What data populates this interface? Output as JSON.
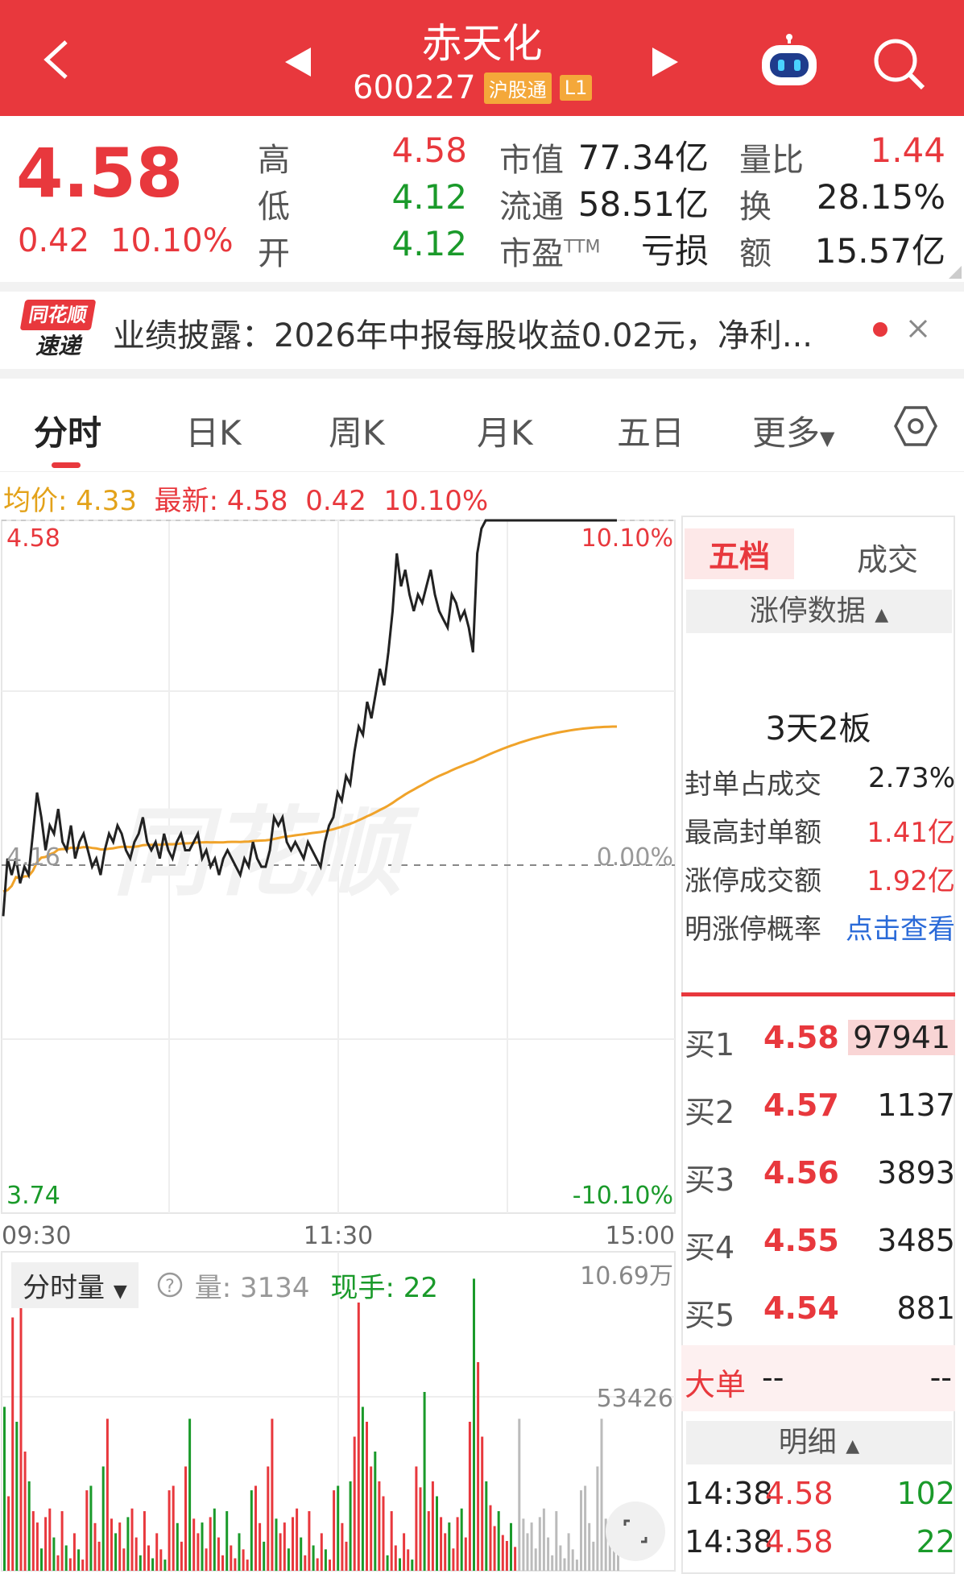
{
  "header": {
    "title": "赤天化",
    "code": "600227",
    "tags": [
      "沪股通",
      "L1"
    ]
  },
  "quote": {
    "price": "4.58",
    "change": "0.42",
    "change_pct": "10.10%",
    "high_label": "高",
    "high": "4.58",
    "low_label": "低",
    "low": "4.12",
    "open_label": "开",
    "open": "4.12",
    "mcap_label": "市值",
    "mcap": "77.34亿",
    "float_label": "流通",
    "float": "58.51亿",
    "pe_label": "市盈",
    "pe_sup": "TTM",
    "pe": "亏损",
    "vr_label": "量比",
    "vr": "1.44",
    "turn_label": "换",
    "turn": "28.15%",
    "amt_label": "额",
    "amt": "15.57亿"
  },
  "news": {
    "logo_top": "同花顺",
    "logo_bottom": "速递",
    "text": "业绩披露：2026年中报每股收益0.02元，净利..."
  },
  "tabs": [
    "分时",
    "日K",
    "周K",
    "月K",
    "五日",
    "更多"
  ],
  "summary": {
    "avg": "均价: 4.33",
    "latest": "最新: 4.58",
    "chg": "0.42",
    "pct": "10.10%"
  },
  "chart": {
    "y_top": "4.58",
    "y_mid": "4.16",
    "y_bot": "3.74",
    "pct_top": "10.10%",
    "pct_mid": "0.00%",
    "pct_bot": "-10.10%",
    "t_start": "09:30",
    "t_mid": "11:30",
    "t_end": "15:00",
    "watermark": "同花顺",
    "vol_max": "10.69万",
    "vol_mid": "53426",
    "vol_select": "分时量",
    "vol_amount": "量: 3134",
    "vol_hand": "现手: 22"
  },
  "right_panel": {
    "tab_five": "五档",
    "tab_deal": "成交",
    "limit_btn": "涨停数据",
    "limit_title": "3天2板",
    "rows": [
      {
        "label": "封单占成交",
        "value": "2.73%"
      },
      {
        "label": "最高封单额",
        "value": "1.41亿"
      },
      {
        "label": "涨停成交额",
        "value": "1.92亿"
      },
      {
        "label": "明涨停概率",
        "value": "点击查看"
      }
    ],
    "bids": [
      {
        "label": "买1",
        "price": "4.58",
        "qty": "97941"
      },
      {
        "label": "买2",
        "price": "4.57",
        "qty": "1137"
      },
      {
        "label": "买3",
        "price": "4.56",
        "qty": "3893"
      },
      {
        "label": "买4",
        "price": "4.55",
        "qty": "3485"
      },
      {
        "label": "买5",
        "price": "4.54",
        "qty": "881"
      }
    ],
    "big_label": "大单",
    "big_a": "--",
    "big_b": "--",
    "detail_btn": "明细",
    "ticks": [
      {
        "time": "14:38",
        "price": "4.58",
        "qty": "102"
      },
      {
        "time": "14:38",
        "price": "4.58",
        "qty": "22"
      }
    ]
  },
  "chart_data": {
    "type": "line",
    "price_series": [
      4.1,
      4.17,
      4.15,
      4.17,
      4.14,
      4.16,
      4.15,
      4.2,
      4.25,
      4.22,
      4.18,
      4.21,
      4.2,
      4.23,
      4.19,
      4.18,
      4.21,
      4.17,
      4.19,
      4.2,
      4.18,
      4.16,
      4.17,
      4.15,
      4.18,
      4.2,
      4.19,
      4.21,
      4.2,
      4.18,
      4.17,
      4.19,
      4.2,
      4.22,
      4.19,
      4.18,
      4.19,
      4.17,
      4.2,
      4.18,
      4.17,
      4.19,
      4.2,
      4.18,
      4.18,
      4.19,
      4.2,
      4.17,
      4.18,
      4.16,
      4.17,
      4.15,
      4.17,
      4.18,
      4.17,
      4.16,
      4.15,
      4.17,
      4.16,
      4.19,
      4.17,
      4.16,
      4.16,
      4.18,
      4.22,
      4.21,
      4.22,
      4.19,
      4.18,
      4.19,
      4.18,
      4.17,
      4.19,
      4.18,
      4.17,
      4.16,
      4.19,
      4.21,
      4.22,
      4.25,
      4.24,
      4.27,
      4.26,
      4.3,
      4.33,
      4.32,
      4.36,
      4.34,
      4.37,
      4.4,
      4.38,
      4.42,
      4.47,
      4.54,
      4.5,
      4.52,
      4.49,
      4.47,
      4.49,
      4.48,
      4.5,
      4.52,
      4.49,
      4.47,
      4.46,
      4.45,
      4.49,
      4.48,
      4.46,
      4.47,
      4.45,
      4.42,
      4.54,
      4.57,
      4.58,
      4.58,
      4.58,
      4.58,
      4.58,
      4.58,
      4.58,
      4.58,
      4.58,
      4.58,
      4.58,
      4.58,
      4.58,
      4.58,
      4.58,
      4.58,
      4.58,
      4.58,
      4.58,
      4.58,
      4.58,
      4.58,
      4.58,
      4.58,
      4.58,
      4.58,
      4.58,
      4.58,
      4.58,
      4.58,
      4.58,
      4.58
    ],
    "avg_series_end": 4.33,
    "ylim": [
      3.74,
      4.58
    ],
    "prev_close": 4.16
  }
}
